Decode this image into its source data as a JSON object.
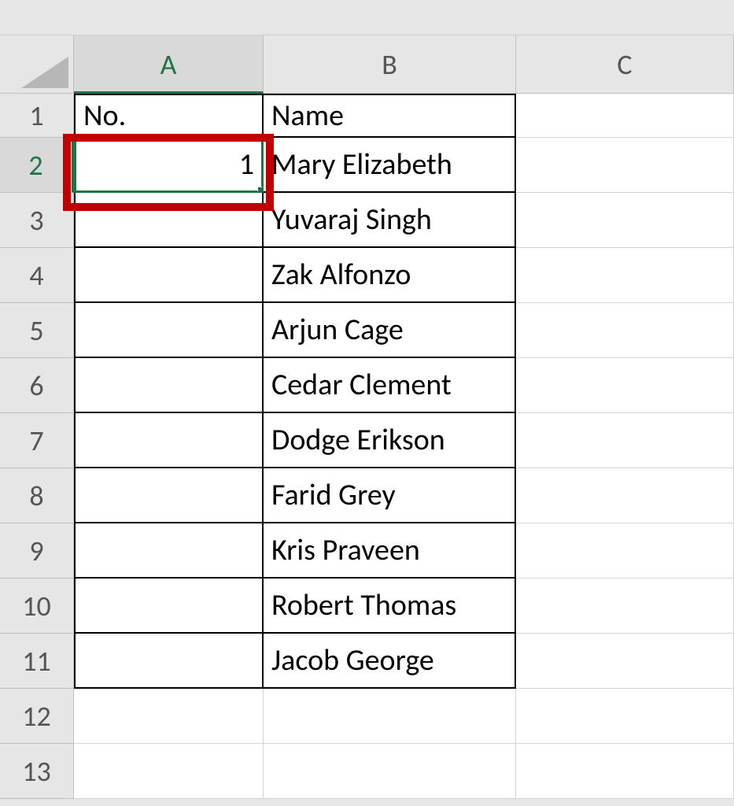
{
  "columns": {
    "A": "A",
    "B": "B",
    "C": "C"
  },
  "rowLabels": [
    "1",
    "2",
    "3",
    "4",
    "5",
    "6",
    "7",
    "8",
    "9",
    "10",
    "11",
    "12",
    "13"
  ],
  "header": {
    "no": "No.",
    "name": "Name"
  },
  "rows": [
    {
      "no": "1",
      "name": "Mary Elizabeth"
    },
    {
      "no": "",
      "name": "Yuvaraj Singh"
    },
    {
      "no": "",
      "name": "Zak Alfonzo"
    },
    {
      "no": "",
      "name": "Arjun Cage"
    },
    {
      "no": "",
      "name": "Cedar Clement"
    },
    {
      "no": "",
      "name": "Dodge Erikson"
    },
    {
      "no": "",
      "name": "Farid Grey"
    },
    {
      "no": "",
      "name": "Kris Praveen"
    },
    {
      "no": "",
      "name": "Robert Thomas"
    },
    {
      "no": "",
      "name": "Jacob George"
    }
  ],
  "activeCell": "A2",
  "highlightCell": "A2"
}
